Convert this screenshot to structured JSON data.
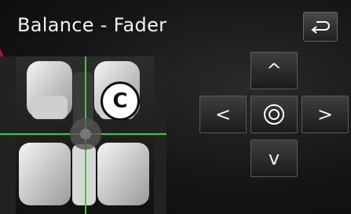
{
  "title": "Balance - Fader",
  "back_button": {
    "icon": "return-arrow-icon"
  },
  "watermark": {
    "text": "C"
  },
  "pad": {
    "up": "^",
    "left": "<",
    "right": ">",
    "down": "v",
    "center_icon": "double-circle-icon"
  },
  "colors": {
    "crosshair": "#2fd42f",
    "accent_red": "#e01030"
  }
}
